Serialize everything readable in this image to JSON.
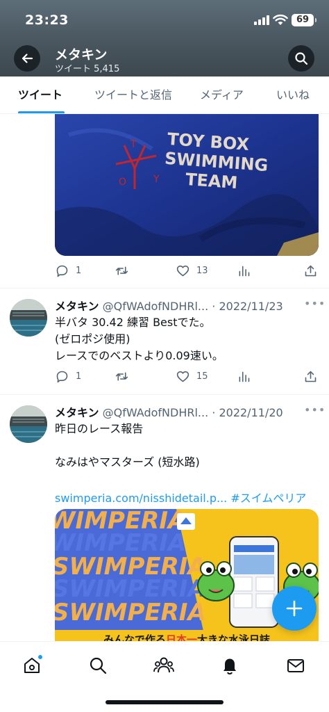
{
  "status_bar": {
    "time": "23:23",
    "battery": "69"
  },
  "header": {
    "name": "メタキン",
    "tweet_count": "ツイート 5,415"
  },
  "tabs": [
    {
      "label": "ツイート",
      "active": true
    },
    {
      "label": "ツイートと返信",
      "active": false
    },
    {
      "label": "メディア",
      "active": false
    },
    {
      "label": "いいね",
      "active": false
    }
  ],
  "tweets": [
    {
      "media_text": [
        "TOY BOX",
        "SWIMMING",
        "TEAM"
      ],
      "logo_letters": [
        "T",
        "O",
        "Y"
      ],
      "stats": {
        "replies": "1",
        "retweets": "",
        "likes": "13"
      }
    },
    {
      "name": "メタキン",
      "handle": "@QfWAdofNDHRl...",
      "date": "· 2022/11/23",
      "lines": [
        "半バタ 30.42 練習 Bestでた。",
        "(ゼロポジ使用)",
        "レースでのベストより0.09速い。"
      ],
      "stats": {
        "replies": "1",
        "retweets": "",
        "likes": "15"
      }
    },
    {
      "name": "メタキン",
      "handle": "@QfWAdofNDHRl...",
      "date": "· 2022/11/20",
      "lines": [
        "昨日のレース報告",
        "",
        "なみはやマスターズ (短水路)",
        ""
      ],
      "link": "swimperia.com/nisshidetail.p...",
      "hashtag": "#スイムペリア",
      "banner": {
        "words": [
          "WIMPERIA",
          "WIMPERIA",
          "SWIMPERIA",
          "SWIMPERIA",
          "SWIMPERIA"
        ],
        "footer_a": "みんなで作る",
        "footer_b": "日本一",
        "footer_c": "大きな水泳日誌"
      }
    }
  ],
  "colors": {
    "accent": "#1d9bf0",
    "text": "#0f1419",
    "muted": "#536471"
  }
}
